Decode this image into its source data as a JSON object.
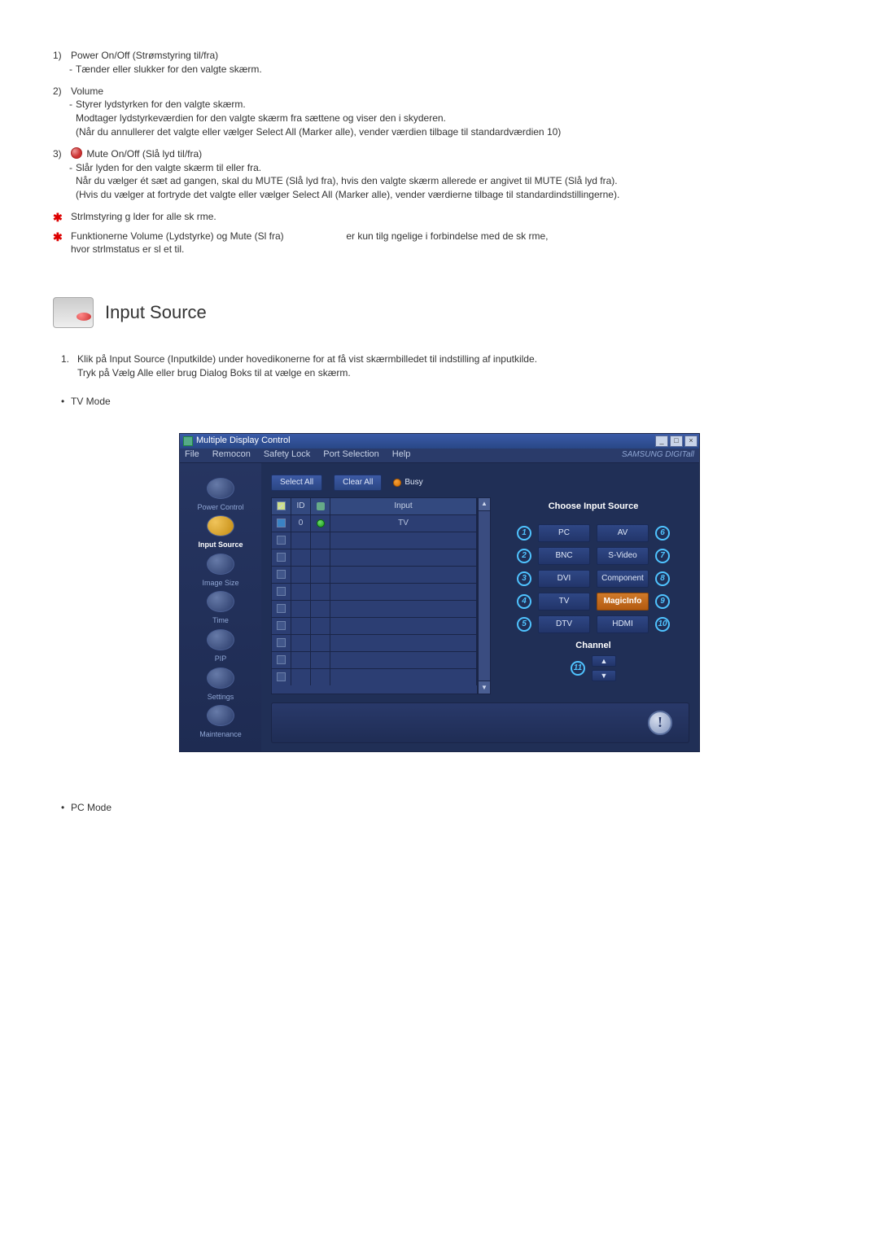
{
  "item1": {
    "num": "1)",
    "title": "Power On/Off (Strømstyring til/fra)",
    "line1": "Tænder eller slukker for den valgte skærm."
  },
  "item2": {
    "num": "2)",
    "title": "Volume",
    "line1": "Styrer lydstyrken for den valgte skærm.",
    "line2": "Modtager lydstyrkeværdien for den valgte skærm fra sættene og viser den i skyderen.",
    "line3": "(Når du annullerer det valgte eller vælger Select All (Marker alle), vender værdien tilbage til standardværdien 10)"
  },
  "item3": {
    "num": "3)",
    "title": "Mute On/Off (Slå lyd til/fra)",
    "line1": "Slår lyden for den valgte skærm til eller fra.",
    "line2": "Når du vælger ét sæt ad gangen, skal du MUTE (Slå lyd fra), hvis den valgte skærm allerede er angivet til MUTE (Slå lyd fra).",
    "line3": "(Hvis du vælger at fortryde det valgte eller vælger Select All (Marker alle), vender værdierne tilbage til standardindstillingerne)."
  },
  "note1": "Strlmstyring g lder for alle sk rme.",
  "note2_a": "Funktionerne Volume (Lydstyrke) og Mute (Sl  fra)",
  "note2_b": "er kun tilg ngelige i forbindelse med de sk rme,",
  "note2_c": "hvor strlmstatus er sl et til.",
  "header": {
    "title": "Input Source"
  },
  "step1": {
    "num": "1.",
    "line1": "Klik på Input Source (Inputkilde) under hovedikonerne for at få vist skærmbilledet til indstilling af inputkilde.",
    "line2": "Tryk på Vælg Alle eller brug Dialog Boks til at vælge en skærm."
  },
  "bullet_tv": "TV Mode",
  "bullet_pc": "PC Mode",
  "ss": {
    "title": "Multiple Display Control",
    "menu": {
      "file": "File",
      "remocon": "Remocon",
      "safety": "Safety Lock",
      "port": "Port Selection",
      "help": "Help",
      "brand": "SAMSUNG DIGITall"
    },
    "sidebar": {
      "power": "Power Control",
      "input": "Input Source",
      "image": "Image Size",
      "time": "Time",
      "pip": "PIP",
      "settings": "Settings",
      "maint": "Maintenance"
    },
    "toolbar": {
      "select_all": "Select All",
      "clear_all": "Clear All",
      "busy": "Busy"
    },
    "table": {
      "head": {
        "id": "ID",
        "input": "Input"
      },
      "row0": {
        "id": "0",
        "input": "TV"
      }
    },
    "panel": {
      "title": "Choose Input Source",
      "pc": "PC",
      "av": "AV",
      "bnc": "BNC",
      "svideo": "S-Video",
      "dvi": "DVI",
      "component": "Component",
      "tv": "TV",
      "magicinfo": "MagicInfo",
      "dtv": "DTV",
      "hdmi": "HDMI",
      "channel": "Channel",
      "c1": "1",
      "c2": "2",
      "c3": "3",
      "c4": "4",
      "c5": "5",
      "c6": "6",
      "c7": "7",
      "c8": "8",
      "c9": "9",
      "c10": "10",
      "c11": "11"
    }
  }
}
